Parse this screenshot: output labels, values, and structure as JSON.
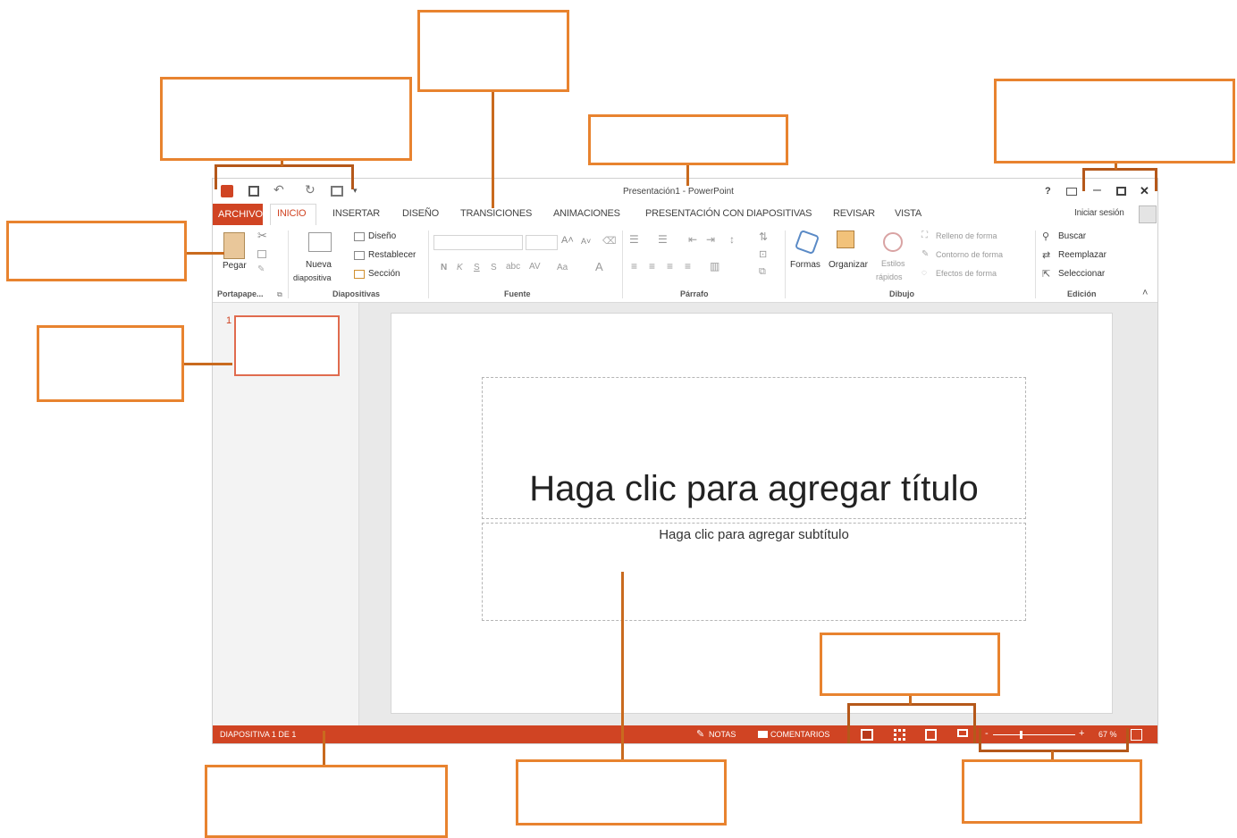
{
  "title_bar": {
    "title": "Presentación1 - PowerPoint",
    "help": "?",
    "minimize": "–",
    "close": "✕"
  },
  "tabs": {
    "file": "ARCHIVO",
    "items": [
      "INICIO",
      "INSERTAR",
      "DISEÑO",
      "TRANSICIONES",
      "ANIMACIONES",
      "PRESENTACIÓN CON DIAPOSITIVAS",
      "REVISAR",
      "VISTA"
    ],
    "sign_in": "Iniciar sesión"
  },
  "ribbon": {
    "clipboard": {
      "paste": "Pegar",
      "group": "Portapape..."
    },
    "slides": {
      "new_slide_1": "Nueva",
      "new_slide_2": "diapositiva",
      "layout": "Diseño",
      "reset": "Restablecer",
      "section": "Sección",
      "group": "Diapositivas"
    },
    "font": {
      "bold": "N",
      "italic": "K",
      "underline": "S",
      "shadow": "S",
      "case": "Aa",
      "group": "Fuente"
    },
    "paragraph": {
      "group": "Párrafo"
    },
    "drawing": {
      "shapes": "Formas",
      "arrange": "Organizar",
      "quick_styles_1": "Estilos",
      "quick_styles_2": "rápidos",
      "fill": "Relleno de forma",
      "outline": "Contorno de forma",
      "effects": "Efectos de forma",
      "group": "Dibujo"
    },
    "editing": {
      "find": "Buscar",
      "replace": "Reemplazar",
      "select": "Seleccionar",
      "group": "Edición"
    }
  },
  "thumbnails": {
    "slide_number": "1"
  },
  "slide": {
    "title_placeholder": "Haga clic para agregar título",
    "subtitle_placeholder": "Haga clic para agregar subtítulo"
  },
  "status_bar": {
    "slide_info": "DIAPOSITIVA 1 DE 1",
    "notes": "NOTAS",
    "comments": "COMENTARIOS",
    "zoom_minus": "-",
    "zoom_plus": "+",
    "zoom_value": "67 %"
  },
  "colors": {
    "accent": "#d04423",
    "callout": "#e8832f"
  }
}
